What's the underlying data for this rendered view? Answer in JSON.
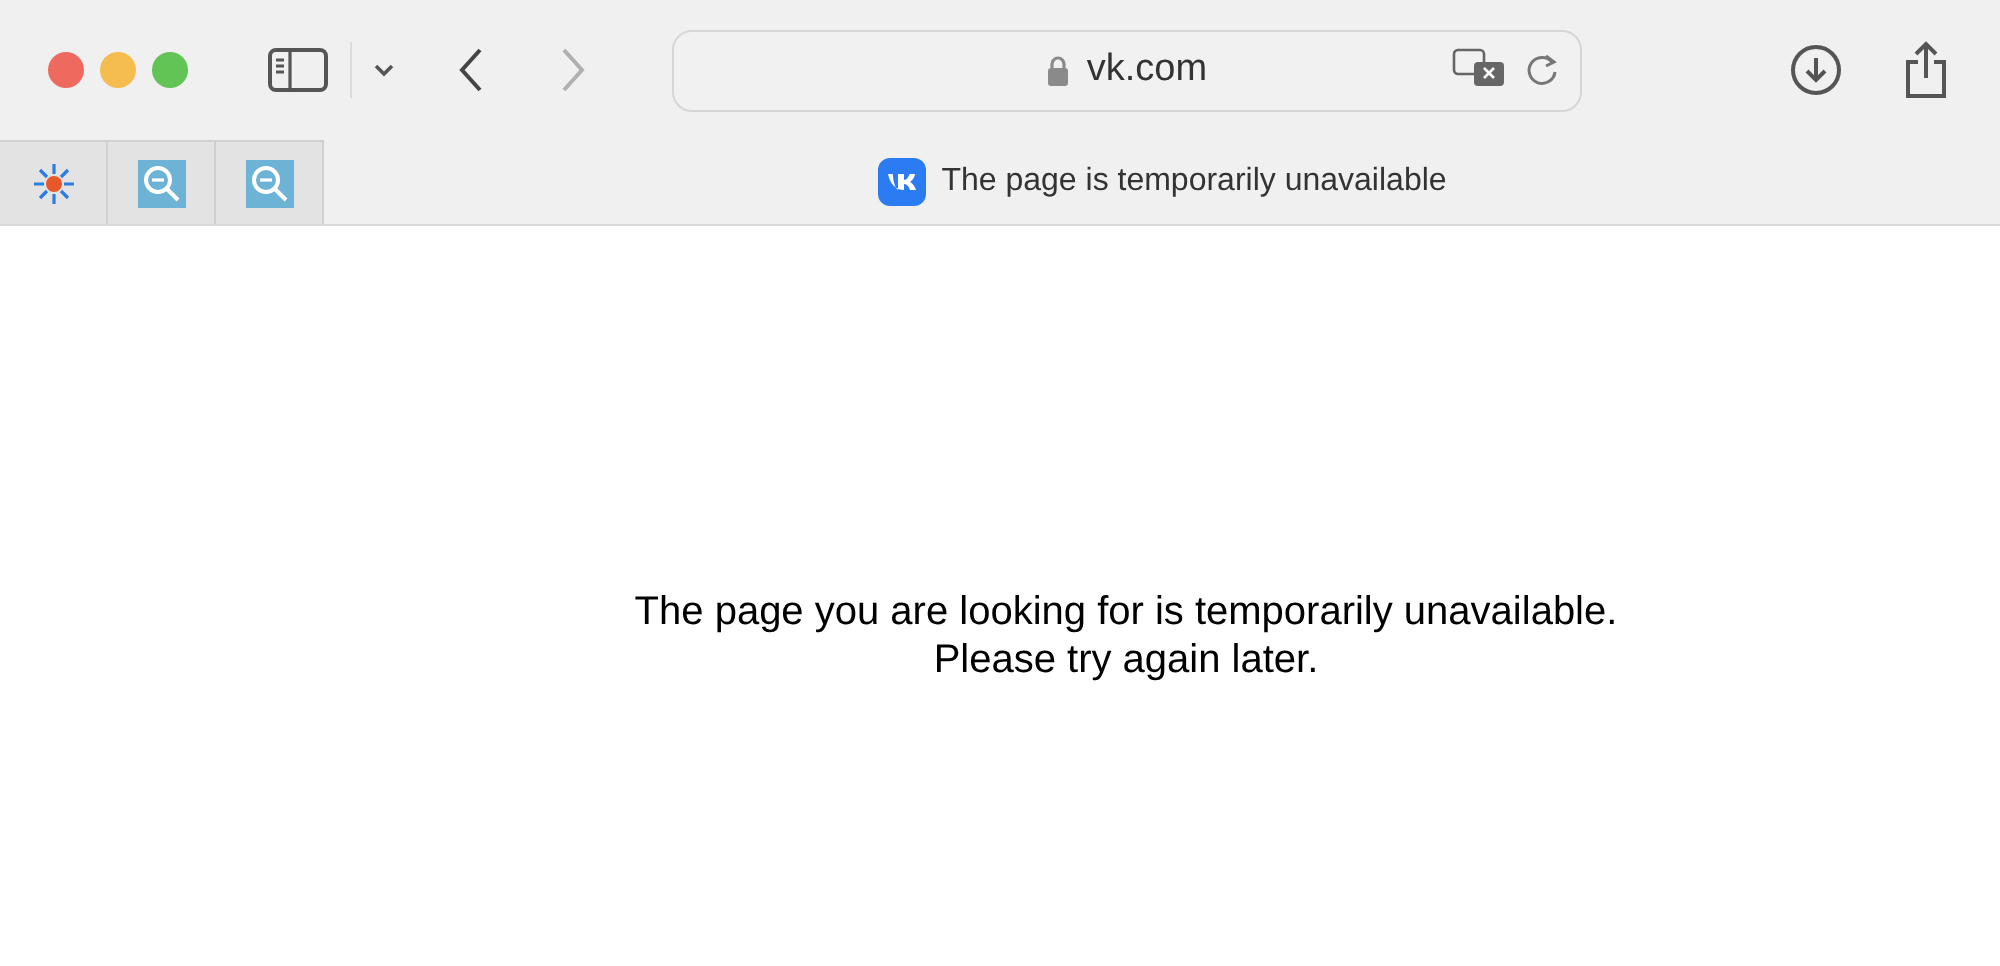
{
  "address_bar": {
    "url": "vk.com"
  },
  "tabs": [
    {
      "kind": "pinned",
      "selected": false
    },
    {
      "kind": "pinned",
      "selected": false
    },
    {
      "kind": "pinned",
      "selected": false
    },
    {
      "kind": "page",
      "title": "The page is temporarily unavailable",
      "selected": true
    }
  ],
  "message": [
    "The page you are looking for is temporarily unavailable.",
    "Please try again later."
  ]
}
